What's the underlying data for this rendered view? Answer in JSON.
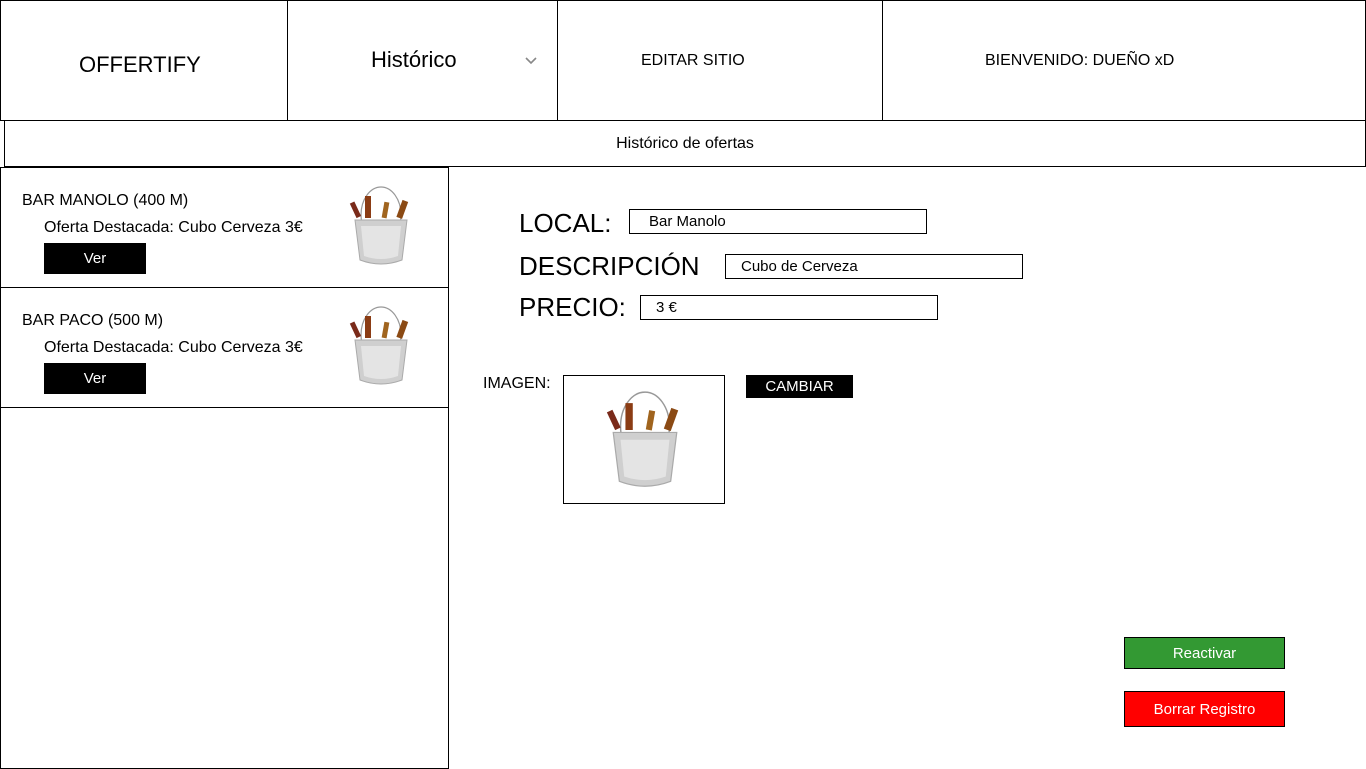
{
  "header": {
    "logo": "OFFERTIFY",
    "nav_dropdown": "Histórico",
    "edit_site": "EDITAR SITIO",
    "welcome": "BIENVENIDO: DUEÑO xD"
  },
  "subheader": {
    "title": "Histórico de ofertas"
  },
  "offers": [
    {
      "name": "BAR MANOLO (400 M)",
      "highlight": "Oferta Destacada: Cubo Cerveza 3€",
      "button": "Ver"
    },
    {
      "name": "BAR PACO (500 M)",
      "highlight": "Oferta Destacada: Cubo Cerveza 3€",
      "button": "Ver"
    }
  ],
  "detail": {
    "local_label": "LOCAL:",
    "local_value": "Bar Manolo",
    "desc_label": "DESCRIPCIÓN",
    "desc_value": "Cubo de Cerveza",
    "price_label": "PRECIO:",
    "price_value": "3 €",
    "image_label": "IMAGEN:",
    "change_button": "CAMBIAR"
  },
  "actions": {
    "reactivate": "Reactivar",
    "delete": "Borrar Registro"
  },
  "colors": {
    "reactivate": "#339933",
    "delete": "#ff0000"
  },
  "icons": {
    "dropdown": "chevron-down-icon",
    "offer_image": "beer-bucket-image"
  }
}
